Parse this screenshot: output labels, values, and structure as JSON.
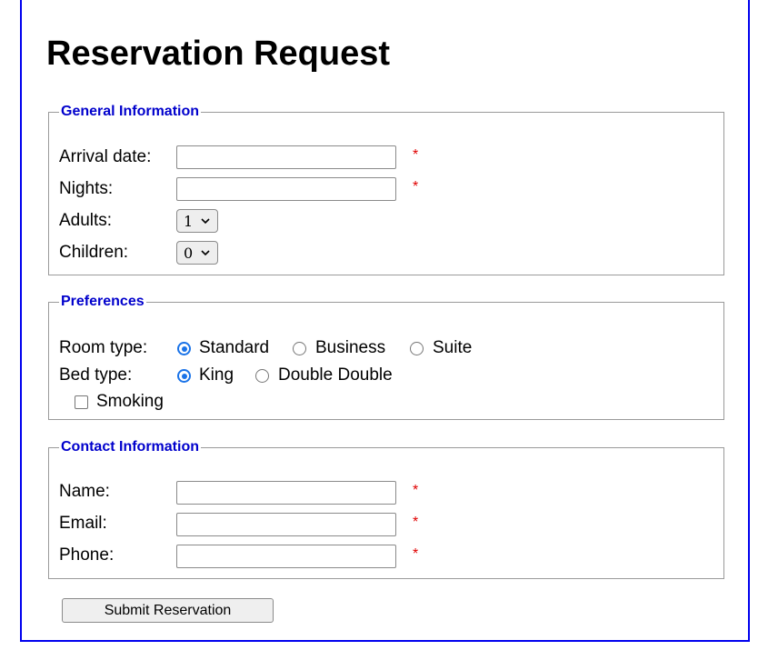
{
  "page": {
    "title": "Reservation Request",
    "accent_color": "#0000ee",
    "required_color": "#e00000"
  },
  "general": {
    "legend": "General Information",
    "arrival_label": "Arrival date:",
    "arrival_value": "",
    "nights_label": "Nights:",
    "nights_value": "",
    "adults_label": "Adults:",
    "adults_value": "1",
    "children_label": "Children:",
    "children_value": "0",
    "required_mark": "*"
  },
  "preferences": {
    "legend": "Preferences",
    "room_label": "Room type:",
    "room_options": [
      "Standard",
      "Business",
      "Suite"
    ],
    "room_selected": "Standard",
    "bed_label": "Bed type:",
    "bed_options": [
      "King",
      "Double Double"
    ],
    "bed_selected": "King",
    "smoking_label": "Smoking",
    "smoking_checked": false
  },
  "contact": {
    "legend": "Contact Information",
    "name_label": "Name:",
    "email_label": "Email:",
    "phone_label": "Phone:",
    "required_mark": "*"
  },
  "submit": {
    "label": "Submit Reservation"
  }
}
